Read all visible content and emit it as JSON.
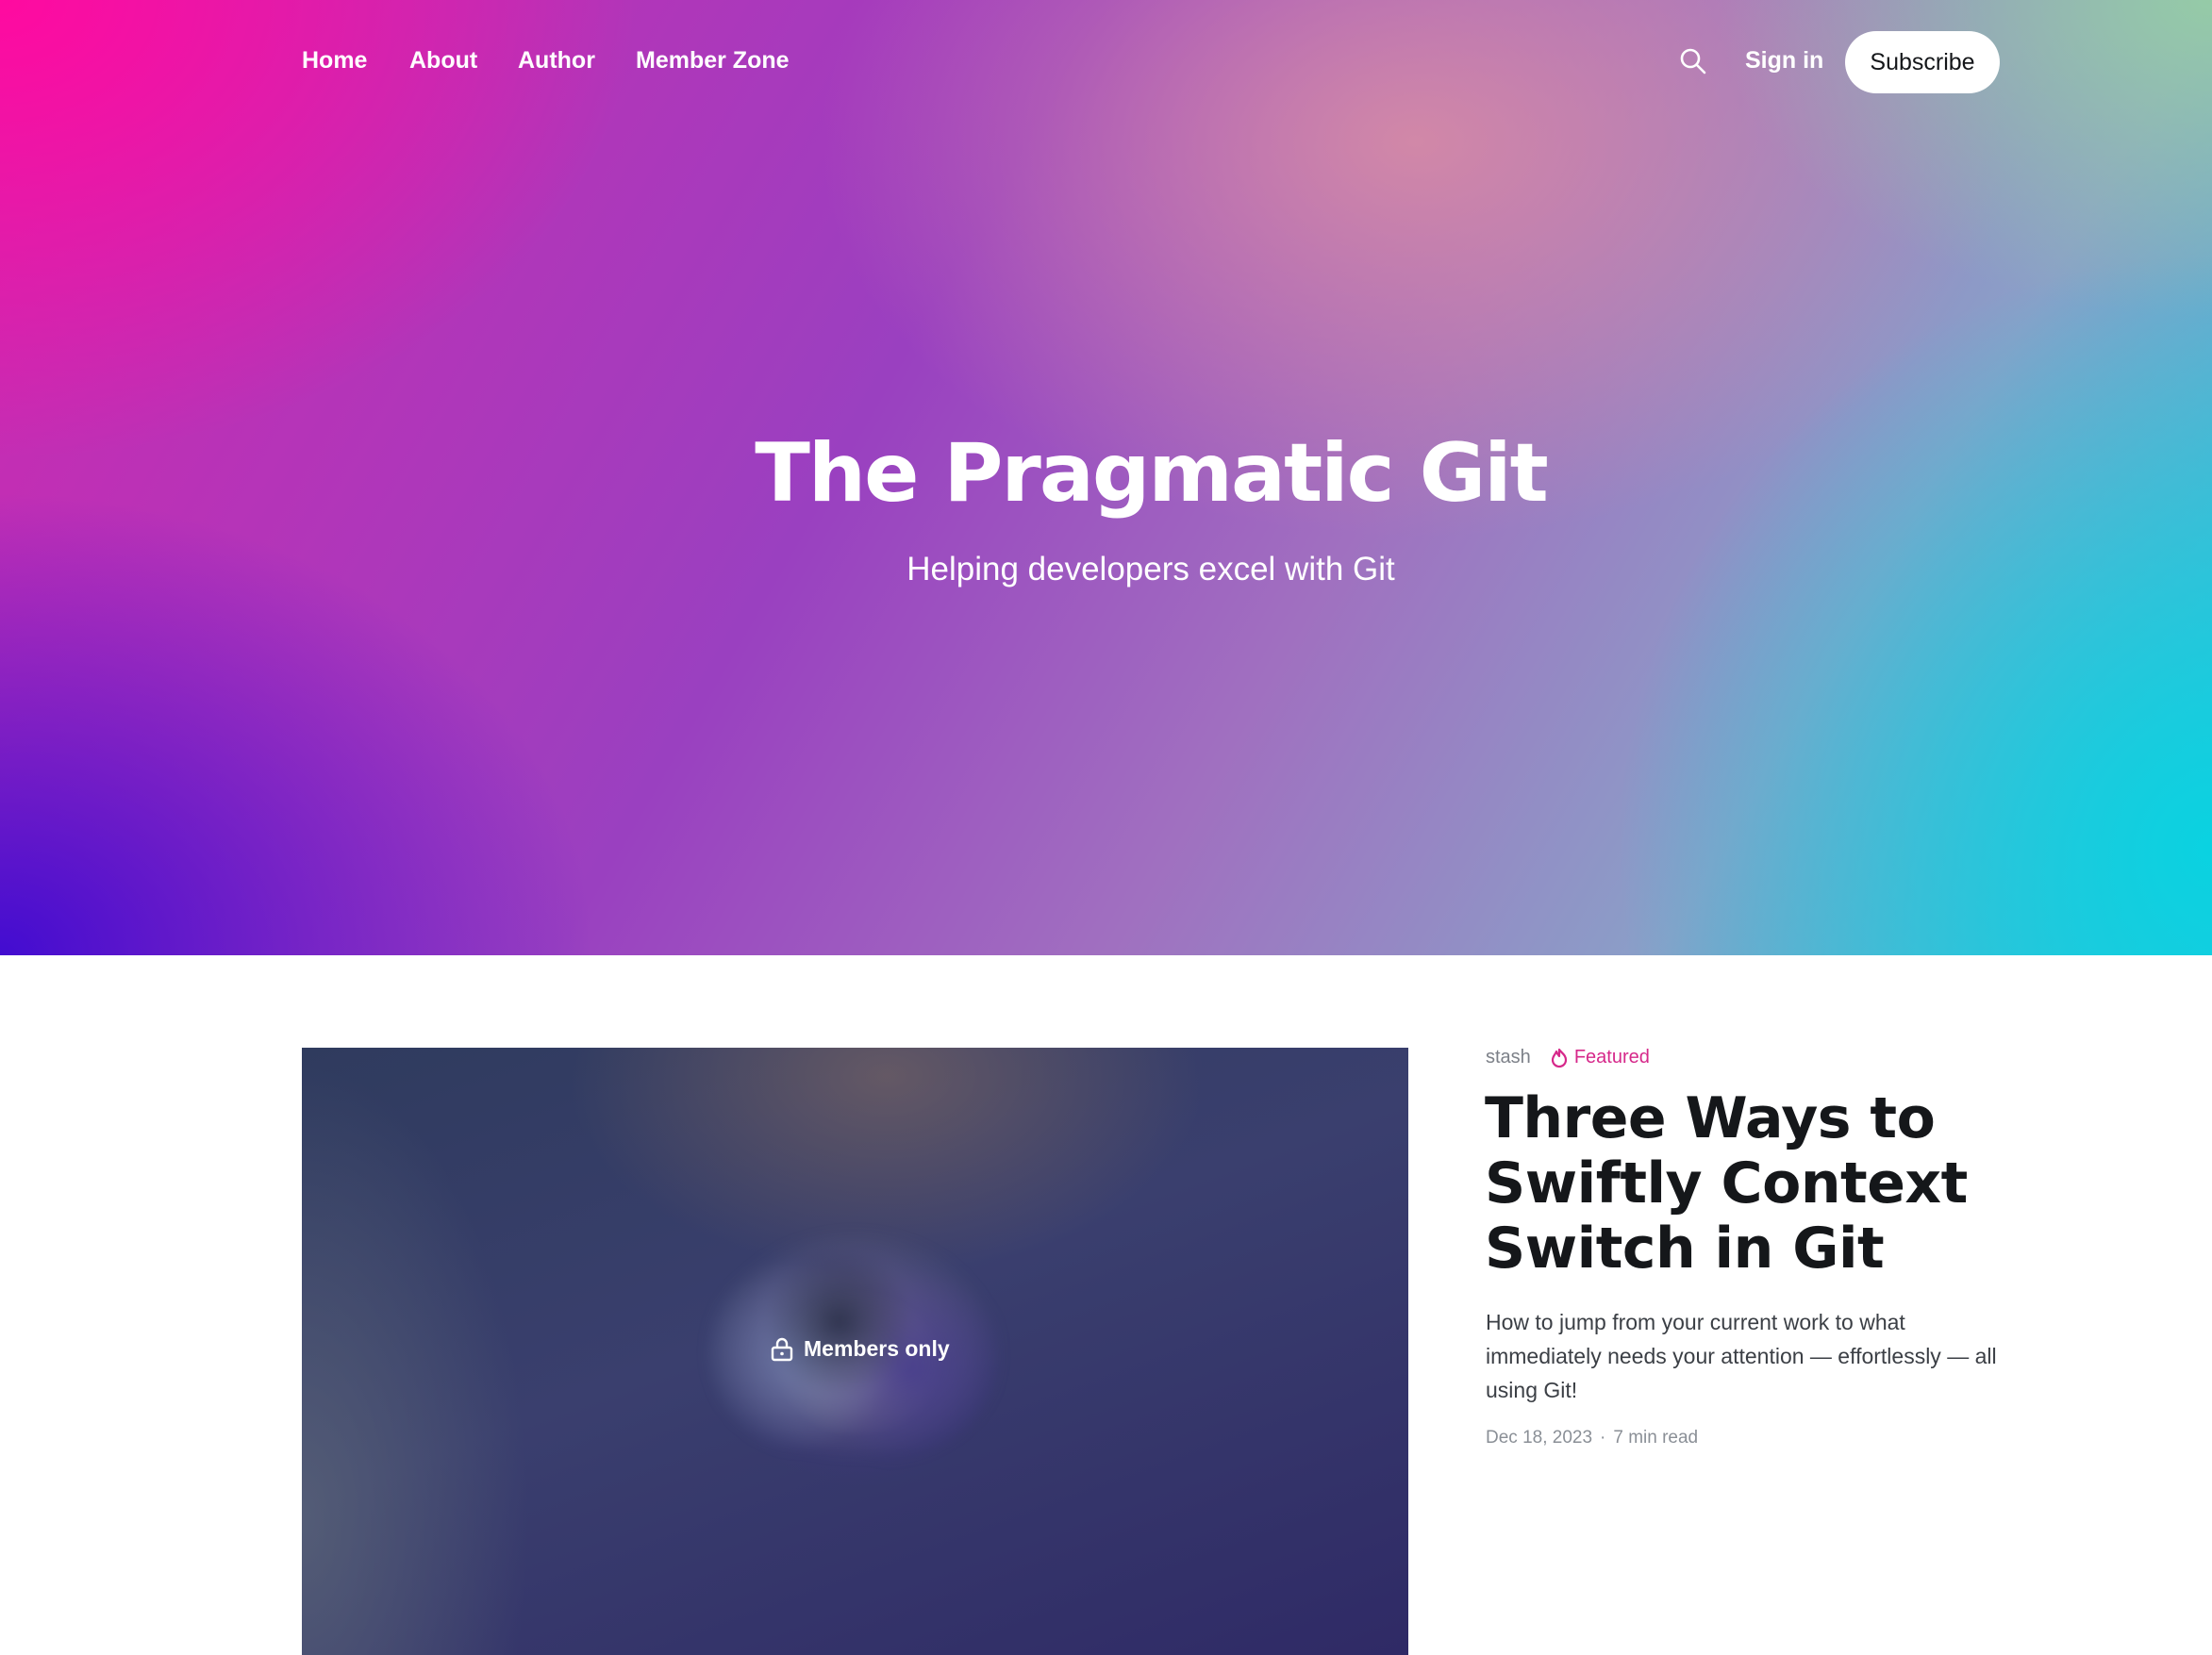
{
  "nav": {
    "items": [
      {
        "label": "Home"
      },
      {
        "label": "About"
      },
      {
        "label": "Author"
      },
      {
        "label": "Member Zone"
      }
    ],
    "search_icon": "search-icon",
    "sign_in": "Sign in",
    "subscribe": "Subscribe"
  },
  "hero": {
    "title": "The Pragmatic Git",
    "subtitle": "Helping developers excel with Git"
  },
  "featured_post": {
    "badge": "Members only",
    "badge_icon": "lock-icon",
    "tag": "stash",
    "featured_label": "Featured",
    "featured_icon": "flame-icon",
    "title": "Three Ways to Swiftly Context Switch in Git",
    "excerpt": "How to jump from your current work to what immediately needs your attention — effortlessly — all using Git!",
    "date": "Dec 18, 2023",
    "read_time": "7 min read"
  },
  "colors": {
    "accent": "#d6288a",
    "hero_pink": "#ff0aa0",
    "hero_purple": "#3c0ad2",
    "hero_cyan": "#0ad2e1"
  }
}
